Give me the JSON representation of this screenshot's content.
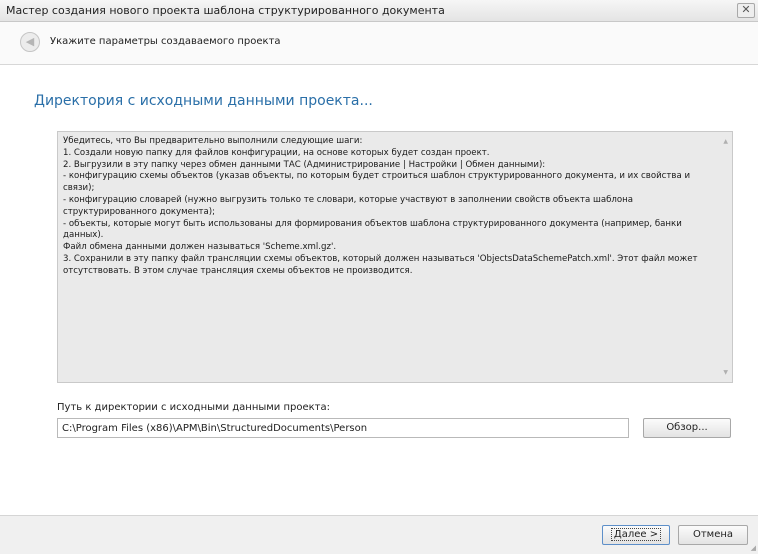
{
  "window": {
    "title": "Мастер создания нового проекта шаблона структурированного документа",
    "close_symbol": "✕"
  },
  "subheader": {
    "back_icon": "arrow-left-icon",
    "step_text": "Укажите параметры создаваемого проекта"
  },
  "page": {
    "title": "Директория с исходными данными проекта..."
  },
  "info": {
    "lines": [
      "Убедитесь, что Вы предварительно выполнили следующие шаги:",
      "1. Создали новую папку для файлов конфигурации, на основе которых будет создан проект.",
      "2. Выгрузили в эту папку через обмен данными ТАС (Администрирование | Настройки | Обмен данными):",
      "    - конфигурацию схемы объектов (указав объекты, по которым будет строиться шаблон структурированного документа, и их свойства и связи);",
      "    - конфигурацию словарей (нужно выгрузить только те словари, которые участвуют в заполнении свойств объекта шаблона структурированного документа);",
      "    - объекты, которые могут быть использованы для формирования объектов шаблона структурированного документа (например, банки данных).",
      "   Файл обмена данными должен называться 'Scheme.xml.gz'.",
      "3. Сохранили в эту папку файл трансляции схемы объектов, который должен называться 'ObjectsDataSchemePatch.xml'. Этот файл может отсутствовать. В этом случае трансляция схемы объектов не производится."
    ]
  },
  "path": {
    "label": "Путь к директории с исходными данными проекта:",
    "value": "C:\\Program Files (x86)\\APM\\Bin\\StructuredDocuments\\Person",
    "browse_label": "Обзор..."
  },
  "footer": {
    "next_label": "Далее >",
    "cancel_label": "Отмена"
  }
}
